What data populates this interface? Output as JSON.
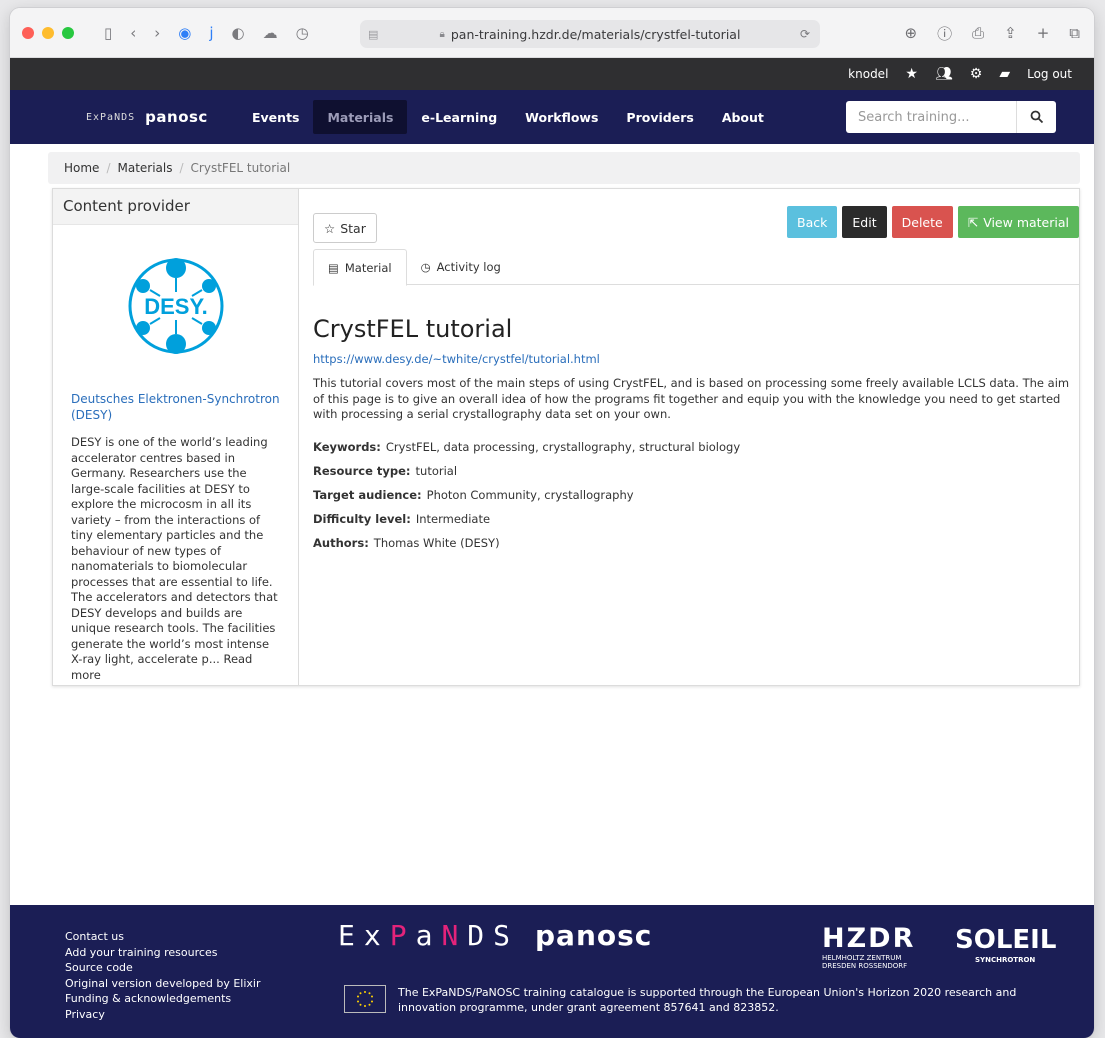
{
  "browser": {
    "url": "pan-training.hzdr.de/materials/crystfel-tutorial"
  },
  "userbar": {
    "username": "knodel",
    "logout": "Log out"
  },
  "nav": {
    "items": [
      {
        "label": "Events"
      },
      {
        "label": "Materials"
      },
      {
        "label": "e-Learning"
      },
      {
        "label": "Workflows"
      },
      {
        "label": "Providers"
      },
      {
        "label": "About"
      }
    ],
    "search_placeholder": "Search training..."
  },
  "breadcrumb": {
    "home": "Home",
    "materials": "Materials",
    "current": "CrystFEL tutorial"
  },
  "sidebar": {
    "heading": "Content provider",
    "logo_text": "DESY.",
    "org_name": "Deutsches Elektronen-Synchrotron (DESY)",
    "description": "DESY is one of the world’s leading accelerator centres based in Germany. Researchers use the large-scale facilities at DESY to explore the microcosm in all its variety – from the interactions of tiny elementary particles and the behaviour of new types of nanomaterials to biomolecular processes that are essential to life. The accelerators and detectors that DESY develops and builds are unique research tools. The facilities generate the world’s most intense X-ray light, accelerate p... Read more"
  },
  "actions": {
    "star": "Star",
    "back": "Back",
    "edit": "Edit",
    "delete": "Delete",
    "view": "View material"
  },
  "tabs": {
    "material": "Material",
    "activity": "Activity log"
  },
  "material": {
    "title": "CrystFEL tutorial",
    "url": "https://www.desy.de/~twhite/crystfel/tutorial.html",
    "description": "This tutorial covers most of the main steps of using CrystFEL, and is based on processing some freely available LCLS data. The aim of this page is to give an overall idea of how the programs fit together and equip you with the knowledge you need to get started with processing a serial crystallography data set on your own.",
    "fields": [
      {
        "label": "Keywords:",
        "value": "CrystFEL, data processing, crystallography, structural biology"
      },
      {
        "label": "Resource type:",
        "value": "tutorial"
      },
      {
        "label": "Target audience:",
        "value": "Photon Community, crystallography"
      },
      {
        "label": "Difficulty level:",
        "value": "Intermediate"
      },
      {
        "label": "Authors:",
        "value": "Thomas White (DESY)"
      }
    ]
  },
  "footer": {
    "links": [
      "Contact us",
      "Add your training resources",
      "Source code",
      "Original version developed by Elixir",
      "Funding & acknowledgements",
      "Privacy"
    ],
    "expands_logo": "ExPaNDS",
    "panosc_logo": "panosc",
    "hzdr_logo": "HZDR",
    "hzdr_sub1": "HELMHOLTZ ZENTRUM",
    "hzdr_sub2": "DRESDEN ROSSENDORF",
    "soleil_logo": "SOLEIL",
    "soleil_sub": "SYNCHROTRON",
    "eu_text_1": "The ExPaNDS/PaNOSC training catalogue is supported through the European Union's Horizon 2020 research and innovation programme, under grant agreement 857641 and 823852."
  },
  "colors": {
    "navbar": "#1b1e55",
    "back": "#5bc0de",
    "edit": "#2b2b2b",
    "delete": "#d9534f",
    "view": "#5cb85c",
    "link": "#2a6ebb",
    "expands_accent": "#e4237a",
    "desy": "#00a0dc"
  }
}
